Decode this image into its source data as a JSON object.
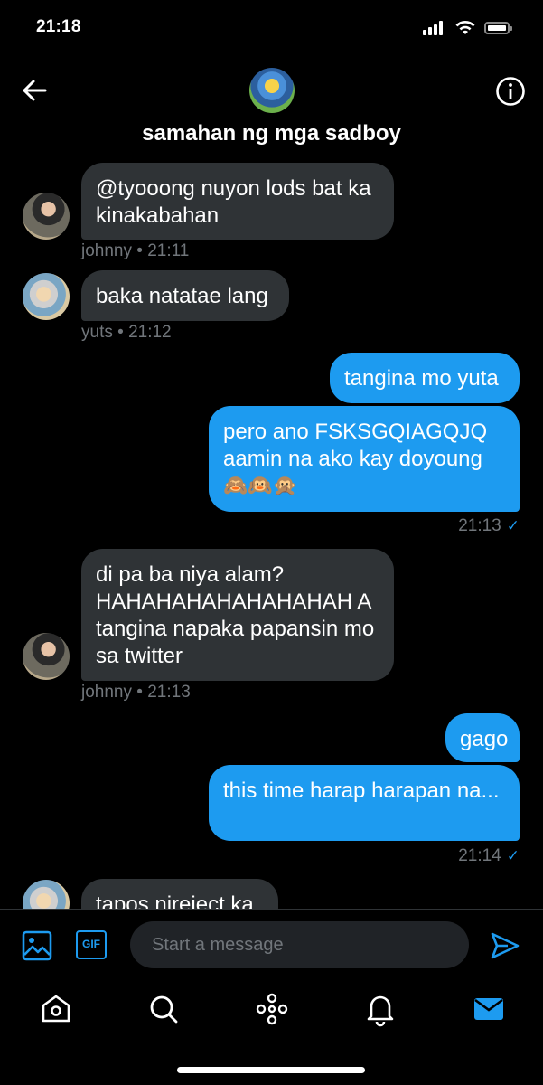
{
  "status_bar": {
    "time": "21:18"
  },
  "header": {
    "title": "samahan ng mga sadboy"
  },
  "messages": [
    {
      "dir": "in",
      "text": "@tyooong nuyon lods bat ka kinakabahan",
      "sender": "johnny",
      "time": "21:11"
    },
    {
      "dir": "in",
      "text": "baka natatae lang",
      "sender": "yuts",
      "time": "21:12"
    },
    {
      "dir": "out",
      "text": "tangina mo yuta"
    },
    {
      "dir": "out",
      "text": "pero ano FSKSGQIAGQJQ aamin na ako kay doyoung",
      "emoji": "🙈🙉🙊",
      "time": "21:13"
    },
    {
      "dir": "in",
      "text": "di pa ba niya alam? HAHAHAHAHAHAHAHAH A tangina napaka papansin mo sa twitter",
      "sender": "johnny",
      "time": "21:13"
    },
    {
      "dir": "out",
      "text": "gago"
    },
    {
      "dir": "out",
      "text": "this time harap harapan na...",
      "time": "21:14"
    },
    {
      "dir": "in",
      "text": "tapos nireject ka"
    }
  ],
  "composer": {
    "placeholder": "Start a message",
    "gif_label": "GIF"
  },
  "colors": {
    "accent": "#1d9bf0",
    "incoming_bubble": "#2f3336",
    "muted": "#71767b"
  },
  "tabbar": [
    {
      "icon": "home-icon"
    },
    {
      "icon": "search-icon"
    },
    {
      "icon": "spaces-icon"
    },
    {
      "icon": "bell-icon"
    },
    {
      "icon": "mail-icon",
      "active": true
    }
  ]
}
